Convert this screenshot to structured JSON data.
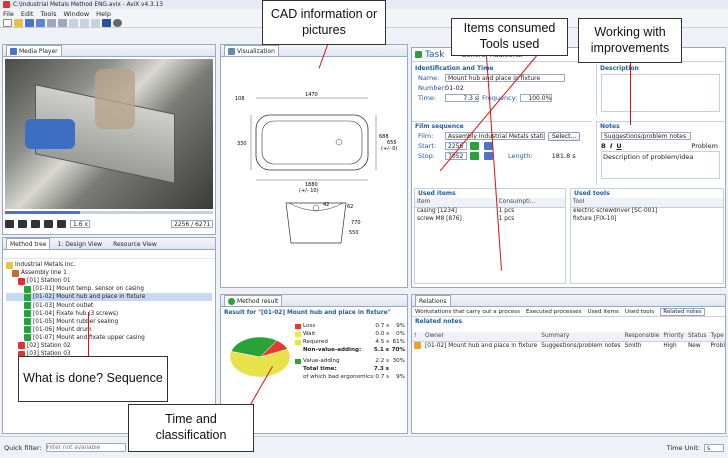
{
  "window": {
    "title": "C:\\Industrial Metals Method ENG.avix - AviX v4.3.13"
  },
  "menu": [
    "File",
    "Edit",
    "Tools",
    "Window",
    "Help"
  ],
  "media_player": {
    "tab": "Media Player",
    "speed": "1.6 x",
    "frame_counter": "2256 / 6271"
  },
  "visualization": {
    "tab": "Visualization",
    "dims": {
      "top_left": "108",
      "top_mid": "1470",
      "left": "330",
      "right_a": "688",
      "right_b": "655",
      "right_c": "(+/- 0)",
      "bottom_a": "1880",
      "bottom_b": "(+/- 10)",
      "circle": "42",
      "side_a": "62",
      "side_b": "770",
      "side_c": "550"
    }
  },
  "task": {
    "title": "Task",
    "tabs": [
      "General",
      "Additional"
    ],
    "identification": {
      "heading": "Identification and Time",
      "name_label": "Name:",
      "name": "Mount hub and place in fixture",
      "number_label": "Number:",
      "number": "01-02",
      "time_label": "Time:",
      "time": "7.3 s",
      "frequency_label": "Frequency:",
      "frequency": "100.0%"
    },
    "film": {
      "heading": "Film sequence",
      "film_label": "Film:",
      "film": "Assembly Industrial Metals station 1.mj",
      "select": "Select...",
      "start_label": "Start:",
      "start": "2256",
      "stop_label": "Stop:",
      "stop": "7052",
      "length_label": "Length:",
      "length": "181.8 s"
    },
    "used_items": {
      "heading": "Used items",
      "cols": [
        "Item",
        "Consumpti..."
      ],
      "rows": [
        [
          "casing [1234]",
          "1 pcs"
        ],
        [
          "screw M8 [876]",
          "1 pcs"
        ]
      ]
    },
    "description": {
      "heading": "Description"
    },
    "notes": {
      "heading": "Notes",
      "dropdown": "Suggestions/problem notes",
      "problem": "Problem",
      "text": "Description of problem/idea"
    },
    "used_tools": {
      "heading": "Used tools",
      "col": "Tool",
      "rows": [
        "electric screwdriver [SC-001]",
        "fixture [FIX-10]"
      ]
    }
  },
  "method_tree": {
    "tabs": [
      "Method tree",
      "1: Design View",
      "Resource View"
    ],
    "rows": [
      {
        "label": "Industrial Metals Inc.",
        "indent": 0
      },
      {
        "label": "Assembly line 1",
        "indent": 1
      },
      {
        "label": "[01] Station 01",
        "indent": 2
      },
      {
        "label": "[01-01] Mount temp. sensor on casing",
        "indent": 3
      },
      {
        "label": "[01-02] Mount hub and place in fixture",
        "indent": 3,
        "selected": true
      },
      {
        "label": "[01-03] Mount outlet",
        "indent": 3
      },
      {
        "label": "[01-04] Fixate hub (3 screws)",
        "indent": 3
      },
      {
        "label": "[01-05] Mount rubber sealing",
        "indent": 3
      },
      {
        "label": "[01-06] Mount drum",
        "indent": 3
      },
      {
        "label": "[01-07] Mount and fixate upper casing",
        "indent": 3
      },
      {
        "label": "[02] Station 02",
        "indent": 2
      },
      {
        "label": "[03] Station 03",
        "indent": 2
      }
    ]
  },
  "method_result": {
    "tab": "Method result",
    "title": "Result for \"[01-02] Mount hub and place in fixture\"",
    "rows": [
      {
        "label": "Loss",
        "time": "0.7 s",
        "pct": "9%",
        "color": "#e63a2e"
      },
      {
        "label": "Wait",
        "time": "0.0 s",
        "pct": "0%",
        "color": "#f5e54a"
      },
      {
        "label": "Required",
        "time": "4.5 s",
        "pct": "61%",
        "color": "#e8e24a"
      },
      {
        "label": "Non-value-adding:",
        "time": "5.1 s",
        "pct": "70%",
        "color": "",
        "bold": true
      },
      {
        "label": "Value-adding",
        "time": "2.2 s",
        "pct": "30%",
        "color": "#2aa23a"
      },
      {
        "label": "Total time:",
        "time": "7.3 s",
        "pct": "",
        "color": "",
        "bold": true
      },
      {
        "label": "of which bad ergonomics:",
        "time": "0.7 s",
        "pct": "9%",
        "color": ""
      }
    ],
    "chart_data": {
      "type": "pie",
      "categories": [
        "Loss",
        "Wait",
        "Required",
        "Value-adding"
      ],
      "values": [
        9,
        0,
        61,
        30
      ],
      "colors": [
        "#e63a2e",
        "#f5e54a",
        "#e8e24a",
        "#2aa23a"
      ]
    }
  },
  "relations": {
    "tab": "Relations",
    "tabs": [
      "Workstations that carry out a process",
      "Executed processes",
      "Used items",
      "Used tools",
      "Related notes"
    ],
    "heading": "Related notes",
    "cols": [
      "!",
      "Owner",
      "Summary",
      "Responsible",
      "Priority",
      "Status",
      "Type"
    ],
    "rows": [
      [
        "",
        "[01-02] Mount hub and place in fixture",
        "Suggestions/problem notes",
        "Smith",
        "High",
        "New",
        "Problem"
      ]
    ]
  },
  "status": {
    "quick_filter_label": "Quick filter:",
    "quick_filter_placeholder": "Filter not available",
    "time_unit_label": "Time Unit:",
    "time_unit": "s"
  },
  "callouts": {
    "cad": "CAD information or pictures",
    "items": "Items consumed Tools used",
    "improve": "Working with improvements",
    "what": "What is done? Sequence",
    "time": "Time and classification"
  }
}
